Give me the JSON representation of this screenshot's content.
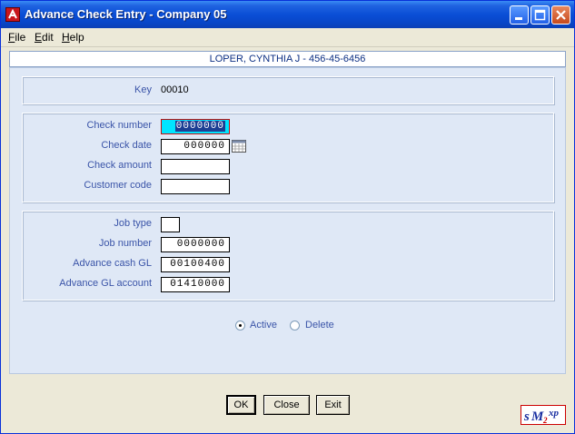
{
  "window": {
    "title": "Advance Check Entry  -  Company 05"
  },
  "menu": {
    "file_key": "F",
    "file_rest": "ile",
    "edit_key": "E",
    "edit_rest": "dit",
    "help_key": "H",
    "help_rest": "elp"
  },
  "header": {
    "employee": "LOPER, CYNTHIA J  -  456-45-6456"
  },
  "key_section": {
    "label": "Key",
    "value": "00010"
  },
  "check_section": {
    "check_number_label": "Check number",
    "check_number_value": "0000000",
    "check_date_label": "Check date",
    "check_date_value": "000000",
    "check_amount_label": "Check amount",
    "check_amount_value": "",
    "customer_code_label": "Customer code",
    "customer_code_value": ""
  },
  "job_section": {
    "job_type_label": "Job type",
    "job_type_value": "",
    "job_number_label": "Job number",
    "job_number_value": "0000000",
    "advance_cash_gl_label": "Advance cash GL",
    "advance_cash_gl_value": "00100400",
    "advance_gl_account_label": "Advance GL account",
    "advance_gl_account_value": "01410000"
  },
  "status": {
    "active_label": "Active",
    "delete_label": "Delete",
    "selected": "Active"
  },
  "buttons": {
    "ok": "OK",
    "close": "Close",
    "exit": "Exit"
  },
  "logo": {
    "text": "sM2xp"
  },
  "colors": {
    "title_bar": "#0a4fd6",
    "label_text": "#3a54a8",
    "focused_field": "#00e5ff",
    "content_bg": "#dfe8f6"
  }
}
